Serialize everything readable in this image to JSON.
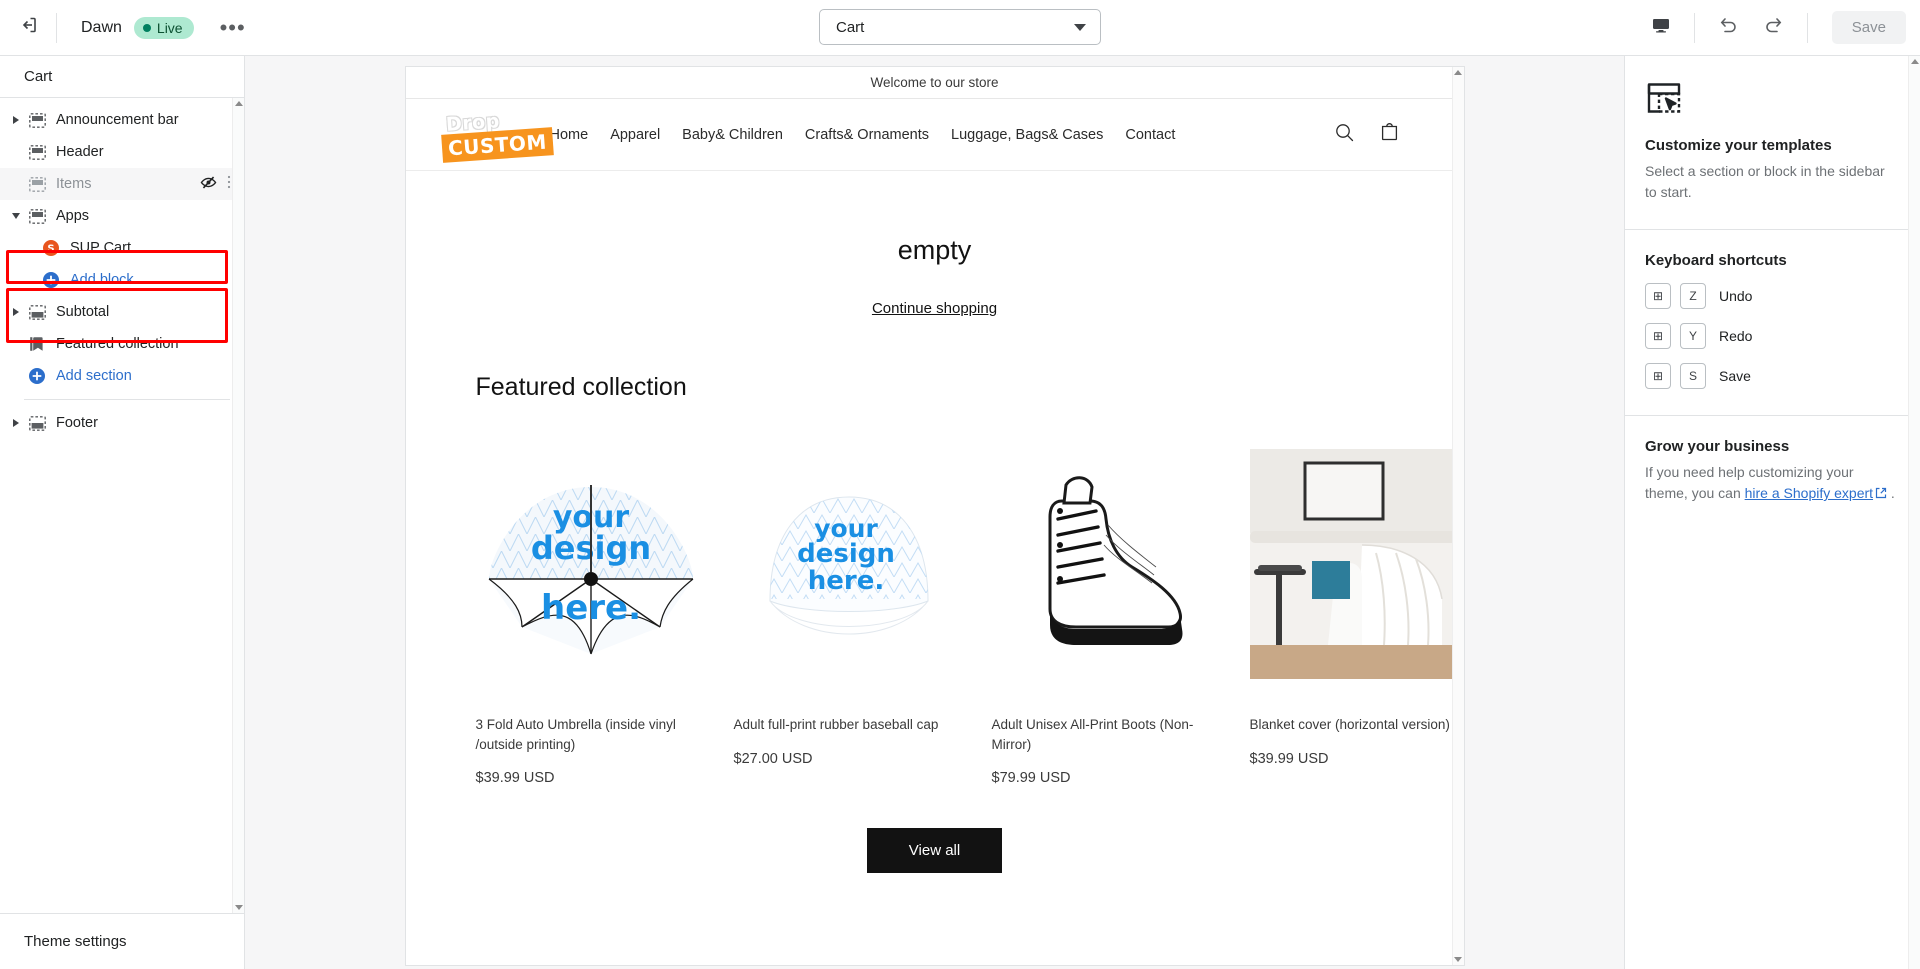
{
  "topbar": {
    "exit_icon": "exit-arrow-icon",
    "theme_name": "Dawn",
    "live_badge": "Live",
    "more_label": "•••",
    "template_selected": "Cart",
    "device_icon": "desktop-icon",
    "undo_icon": "undo-icon",
    "redo_icon": "redo-icon",
    "save_label": "Save"
  },
  "sidebar": {
    "title": "Cart",
    "items": [
      {
        "label": "Announcement bar",
        "icon": "section-icon",
        "twisty": "right",
        "indent": false
      },
      {
        "label": "Header",
        "icon": "section-icon",
        "twisty": "none",
        "indent": false
      },
      {
        "label": "Items",
        "icon": "section-icon",
        "twisty": "none",
        "indent": false,
        "hidden": true,
        "eye_icon": "eye-off-icon",
        "drag_icon": "drag-handle-icon"
      },
      {
        "label": "Apps",
        "icon": "section-icon",
        "twisty": "down",
        "indent": false
      },
      {
        "label": "SUP Cart",
        "icon": "sup-cart-app-icon",
        "twisty": "none",
        "indent": true
      },
      {
        "label": "Add block",
        "icon": "plus-circle-icon",
        "twisty": "none",
        "indent": true,
        "link": true
      },
      {
        "label": "Subtotal",
        "icon": "section-icon",
        "twisty": "right",
        "indent": false
      },
      {
        "label": "Featured collection",
        "icon": "collection-tag-icon",
        "twisty": "none",
        "indent": false
      },
      {
        "label": "Add section",
        "icon": "plus-circle-icon",
        "twisty": "none",
        "indent": false,
        "link": true
      },
      {
        "label": "Footer",
        "icon": "section-icon",
        "twisty": "right",
        "indent": false
      }
    ],
    "footer_label": "Theme settings"
  },
  "preview": {
    "announcement": "Welcome to our store",
    "logo": {
      "line1": "Drop",
      "line2": "CUSTOM",
      "color": "#f7941e"
    },
    "nav": [
      "Home",
      "Apparel",
      "Baby& Children",
      "Crafts& Ornaments",
      "Luggage, Bags& Cases",
      "Contact"
    ],
    "search_icon": "search-icon",
    "cart_icon": "shopping-bag-icon",
    "cart_empty_title": "empty",
    "continue_shopping": "Continue shopping",
    "featured_title": "Featured collection",
    "products": [
      {
        "title": "3 Fold Auto Umbrella (inside vinyl /outside printing)",
        "price": "$39.99 USD",
        "image": "umbrella-your-design-here"
      },
      {
        "title": "Adult full-print rubber baseball cap",
        "price": "$27.00 USD",
        "image": "baseball-cap-your-design-here"
      },
      {
        "title": "Adult Unisex All-Print Boots (Non-Mirror)",
        "price": "$79.99 USD",
        "image": "white-boot"
      },
      {
        "title": "Blanket cover (horizontal version)",
        "price": "$39.99 USD",
        "image": "white-blanket-on-sofa"
      }
    ],
    "view_all": "View all"
  },
  "rightpanel": {
    "template_icon": "template-cursor-icon",
    "customize_title": "Customize your templates",
    "customize_sub": "Select a section or block in the sidebar to start.",
    "shortcuts_title": "Keyboard shortcuts",
    "shortcuts": [
      {
        "mod": "⊞",
        "key": "Z",
        "label": "Undo"
      },
      {
        "mod": "⊞",
        "key": "Y",
        "label": "Redo"
      },
      {
        "mod": "⊞",
        "key": "S",
        "label": "Save"
      }
    ],
    "grow_title": "Grow your business",
    "grow_text_before": "If you need help customizing your theme, you can ",
    "grow_link": "hire a Shopify expert",
    "grow_text_after": " ."
  },
  "annotations": {
    "highlight_color": "#ff0000",
    "boxes": [
      "items-row",
      "apps-group"
    ]
  }
}
